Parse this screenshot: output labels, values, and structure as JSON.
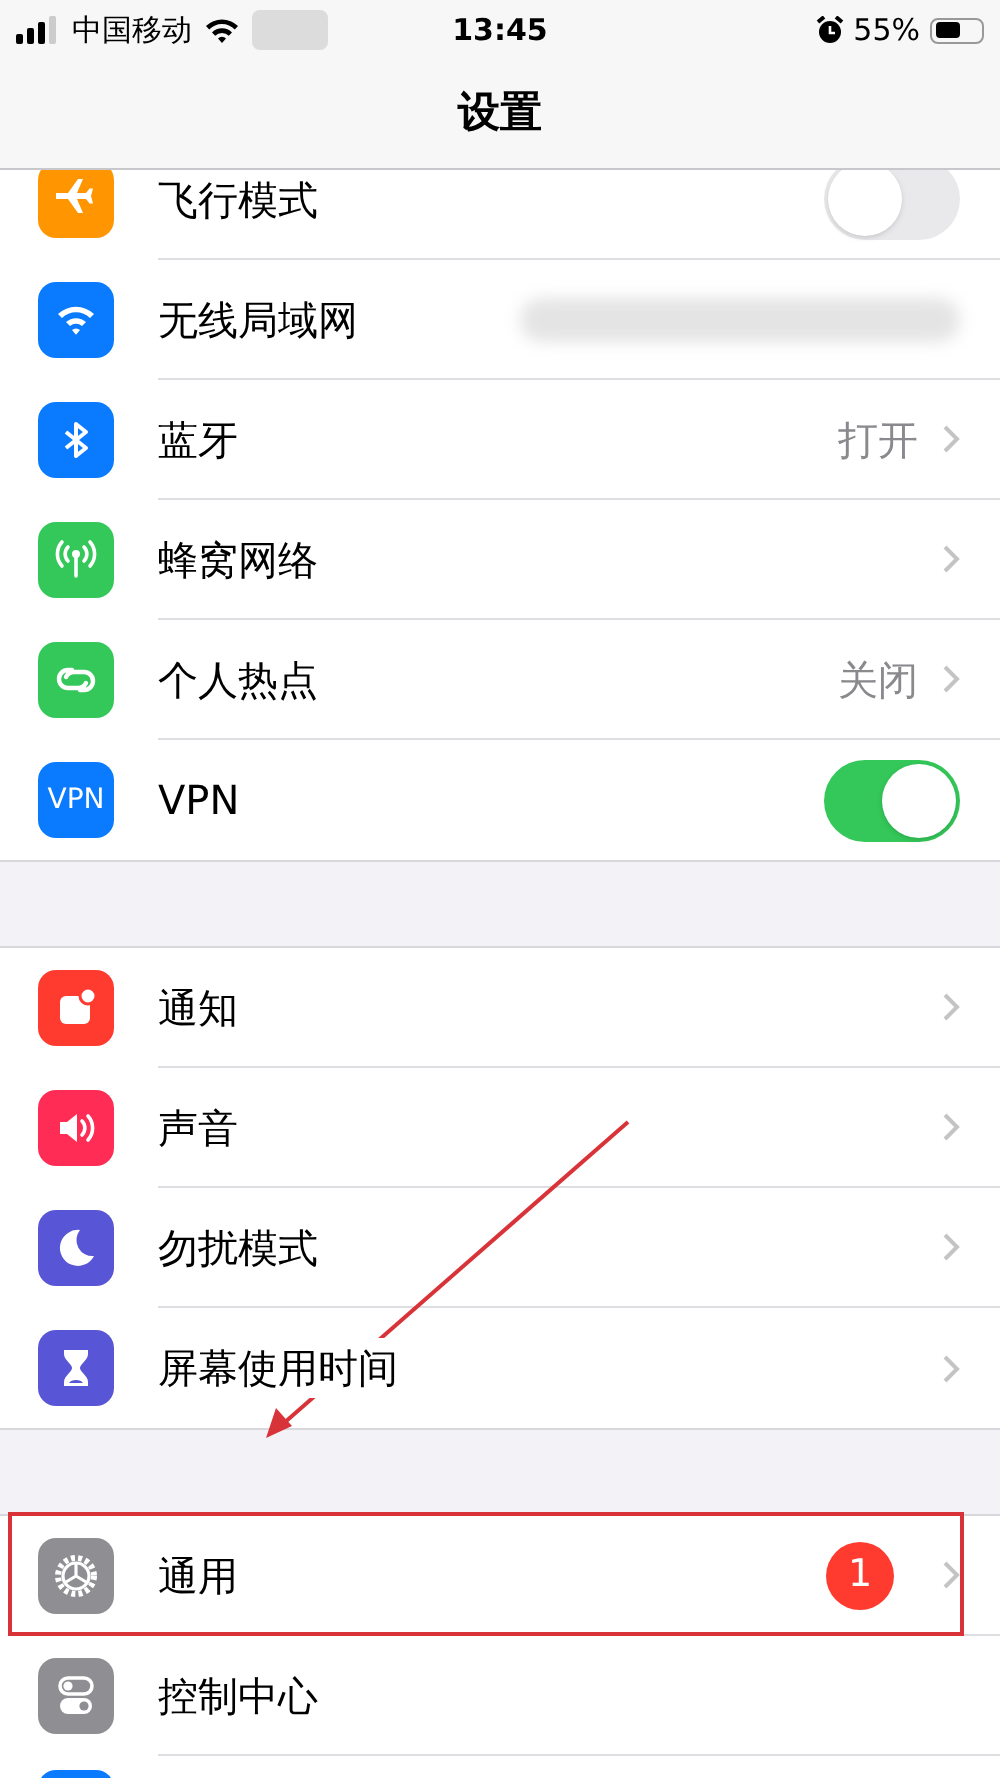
{
  "status_bar": {
    "carrier": "中国移动",
    "time": "13:45",
    "battery": "55%"
  },
  "nav": {
    "title": "设置"
  },
  "groups": [
    {
      "rows": [
        {
          "kind": "toggle",
          "label": "飞行模式",
          "color": "#ff9500",
          "on": false
        },
        {
          "kind": "redacted",
          "label": "无线局域网",
          "color": "#0a7aff"
        },
        {
          "kind": "link",
          "label": "蓝牙",
          "color": "#0a7aff",
          "value": "打开"
        },
        {
          "kind": "link",
          "label": "蜂窝网络",
          "color": "#34c759"
        },
        {
          "kind": "link",
          "label": "个人热点",
          "color": "#34c759",
          "value": "关闭"
        },
        {
          "kind": "toggle",
          "label": "VPN",
          "color": "#0a7aff",
          "icon_text": "VPN",
          "on": true
        }
      ]
    },
    {
      "rows": [
        {
          "kind": "link",
          "label": "通知",
          "color": "#ff3b30"
        },
        {
          "kind": "link",
          "label": "声音",
          "color": "#ff2d55"
        },
        {
          "kind": "link",
          "label": "勿扰模式",
          "color": "#5856d6"
        },
        {
          "kind": "link",
          "label": "屏幕使用时间",
          "color": "#5856d6"
        }
      ]
    },
    {
      "rows": [
        {
          "kind": "link",
          "label": "通用",
          "color": "#8e8e93",
          "badge": "1",
          "highlighted": true
        },
        {
          "kind": "plain",
          "label": "控制中心",
          "color": "#8e8e93"
        },
        {
          "kind": "plain",
          "color": "#0a7aff"
        }
      ]
    }
  ]
}
